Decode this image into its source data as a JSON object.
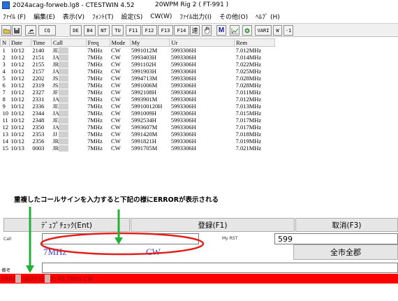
{
  "window": {
    "title": "2024acag-forweb.lg8  -  CTESTWIN  4.52",
    "rig": "20WPM  Rig 2 ( FT-991 )"
  },
  "menu": [
    "ﾌｧｲﾙ (F)",
    "編集(E)",
    "表示(V)",
    "ﾌｫﾝﾄ(T)",
    "設定(S)",
    "CW(W)",
    "ﾌｧｲﾙ出力(I)",
    "その他(O)",
    "ﾍﾙﾌﾟ (H)"
  ],
  "toolbar": {
    "cq": "CQ",
    "de": "DE",
    "b4": "B4",
    "nt": "NT",
    "tu": "TU",
    "f11": "F11",
    "f12": "F12",
    "f13": "F13",
    "f14": "F14",
    "speed": "速",
    "m": "M",
    "vari": "VARI",
    "w": "W",
    "minus1": "-1"
  },
  "table": {
    "columns": [
      "N",
      "Date",
      "Time",
      "Call",
      "Freq",
      "Mode",
      "My",
      "Ur",
      "Rem"
    ],
    "rows": [
      [
        "1",
        "10/12",
        "2140",
        "JE",
        "7MHz",
        "CW",
        "5991012M",
        "5993306H",
        "7.012MHz"
      ],
      [
        "2",
        "10/12",
        "2151",
        "JA",
        "7MHz",
        "CW",
        "5993403H",
        "5993306H",
        "7.014MHz"
      ],
      [
        "3",
        "10/12",
        "2155",
        "JR",
        "7MHz",
        "CW",
        "5991102H",
        "5993306H",
        "7.022MHz"
      ],
      [
        "4",
        "10/12",
        "2157",
        "JA",
        "7MHz",
        "CW",
        "5991903H",
        "5993306H",
        "7.025MHz"
      ],
      [
        "5",
        "10/12",
        "2202",
        "JS",
        "7MHz",
        "CW",
        "5994713M",
        "5993306H",
        "7.028MHz"
      ],
      [
        "6",
        "10/12",
        "2319",
        "JS",
        "7MHz",
        "CW",
        "5991006M",
        "5993306H",
        "7.028MHz"
      ],
      [
        "7",
        "10/12",
        "2327",
        "JF",
        "7MHz",
        "CW",
        "5992108H",
        "5993306H",
        "7.011MHz"
      ],
      [
        "8",
        "10/12",
        "2331",
        "JA",
        "7MHz",
        "CW",
        "5993901M",
        "5993306H",
        "7.012MHz"
      ],
      [
        "9",
        "10/12",
        "2336",
        "JE",
        "7MHz",
        "CW",
        "599100120H",
        "5993306H",
        "7.013MHz"
      ],
      [
        "10",
        "10/12",
        "2344",
        "JA",
        "7MHz",
        "CW",
        "5991009H",
        "5993306H",
        "7.015MHz"
      ],
      [
        "11",
        "10/12",
        "2348",
        "JE",
        "7MHz",
        "CW",
        "5992534H",
        "5993306H",
        "7.017MHz"
      ],
      [
        "12",
        "10/12",
        "2350",
        "JA",
        "7MHz",
        "CW",
        "5993607M",
        "5993306H",
        "7.017MHz"
      ],
      [
        "13",
        "10/12",
        "2353",
        "JJ",
        "7MHz",
        "CW",
        "5991420M",
        "5993306H",
        "7.018MHz"
      ],
      [
        "14",
        "10/12",
        "2356",
        "JR",
        "7MHz",
        "CW",
        "5991821H",
        "5993306H",
        "7.019MHz"
      ],
      [
        "15",
        "10/13",
        "0003",
        "JR",
        "7MHz",
        "CW",
        "5991705M",
        "5993306H",
        "7.021MHz"
      ]
    ]
  },
  "annotation": "重複したコールサインを入力すると下記の様にERRORが表示される",
  "buttons": {
    "dupe_check": "ﾃﾞｭﾌﾟﾁｪｯｸ(Ent)",
    "register": "登録(F1)",
    "cancel": "取消(F3)"
  },
  "entry": {
    "call_label": "Call",
    "call_value": "",
    "my_rst_label": "My RST",
    "my_rst_value": "599",
    "freq": "7MHz",
    "mode": "CW",
    "city_button": "全市全郡",
    "remarks_label": "備考"
  },
  "status": {
    "text": "ERROR  0003  日(12) 40  7MHz  CW"
  },
  "colors": {
    "error_bar": "#ff0000",
    "ellipse": "#e0201a",
    "arrow": "#22b03a",
    "freq_text": "#3a3ad8"
  }
}
